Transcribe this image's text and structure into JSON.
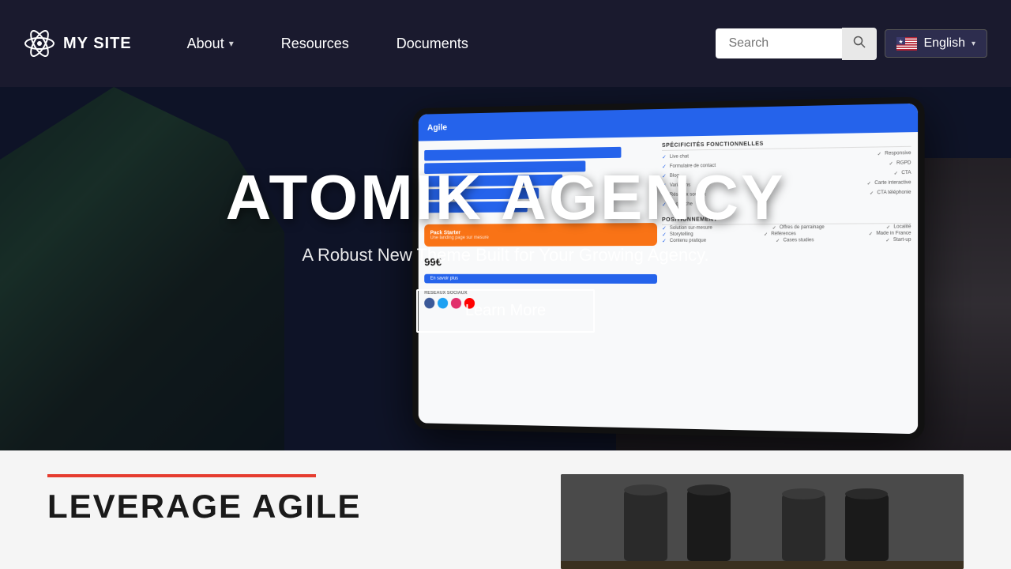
{
  "site": {
    "logo_text": "MY SITE",
    "logo_icon": "atom"
  },
  "navbar": {
    "links": [
      {
        "id": "about",
        "label": "About",
        "has_dropdown": true
      },
      {
        "id": "resources",
        "label": "Resources",
        "has_dropdown": false
      },
      {
        "id": "documents",
        "label": "Documents",
        "has_dropdown": false
      }
    ],
    "search": {
      "placeholder": "Search",
      "value": ""
    },
    "language": {
      "label": "English",
      "flag": "us"
    }
  },
  "hero": {
    "title": "ATOMIK AGENCY",
    "subtitle": "A Robust New Theme Built for Your Growing Agency.",
    "cta_button": "Learn More"
  },
  "tablet": {
    "header_text": "Agile",
    "chart_bars": [
      85,
      70,
      60,
      50,
      45
    ],
    "section1_title": "SPÉCIFICITÉS FONCTIONNELLES",
    "features": [
      "Live chat",
      "Responsive",
      "Formulaire de contact",
      "RGPD",
      "Blog",
      "CTA",
      "Variations",
      "Carte interactive",
      "Réseaux sociaux",
      "CTA téléphonie",
      "Recherche"
    ],
    "section2_title": "POSITIONNEMENT",
    "pack_name": "Pack Starter",
    "pack_price": "99€",
    "pack_btn": "En savoir plus",
    "section3_title": "RÉSEAUX SOCIAUX"
  },
  "below_hero": {
    "title": "LEVERAGE AGILE",
    "accent_color": "#e63c2f"
  }
}
